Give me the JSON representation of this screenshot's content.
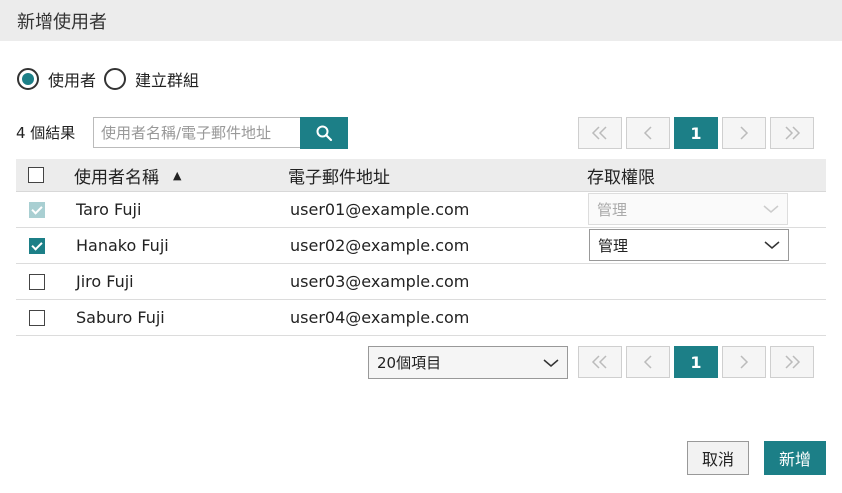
{
  "dialog": {
    "title": "新增使用者"
  },
  "mode": {
    "options": [
      {
        "label": "使用者",
        "selected": true
      },
      {
        "label": "建立群組",
        "selected": false
      }
    ]
  },
  "search": {
    "result_count": "4 個結果",
    "placeholder": "使用者名稱/電子郵件地址"
  },
  "pager_top": {
    "first": "«",
    "prev": "‹",
    "page": "1",
    "next": "›",
    "last": "»"
  },
  "table": {
    "columns": {
      "name": "使用者名稱",
      "email": "電子郵件地址",
      "access": "存取權限"
    },
    "sort_indicator": "▲",
    "rows": [
      {
        "name": "Taro Fuji",
        "email": "user01@example.com",
        "checked": true,
        "disabled": true,
        "access": "管理"
      },
      {
        "name": "Hanako Fuji",
        "email": "user02@example.com",
        "checked": true,
        "disabled": false,
        "access": "管理"
      },
      {
        "name": "Jiro Fuji",
        "email": "user03@example.com",
        "checked": false,
        "disabled": false,
        "access": ""
      },
      {
        "name": "Saburo Fuji",
        "email": "user04@example.com",
        "checked": false,
        "disabled": false,
        "access": ""
      }
    ]
  },
  "page_size": {
    "value": "20個項目"
  },
  "pager_bottom": {
    "first": "«",
    "prev": "‹",
    "page": "1",
    "next": "›",
    "last": "»"
  },
  "actions": {
    "cancel": "取消",
    "add": "新增"
  },
  "colors": {
    "accent": "#1c7f87",
    "header_bg": "#ececec"
  }
}
